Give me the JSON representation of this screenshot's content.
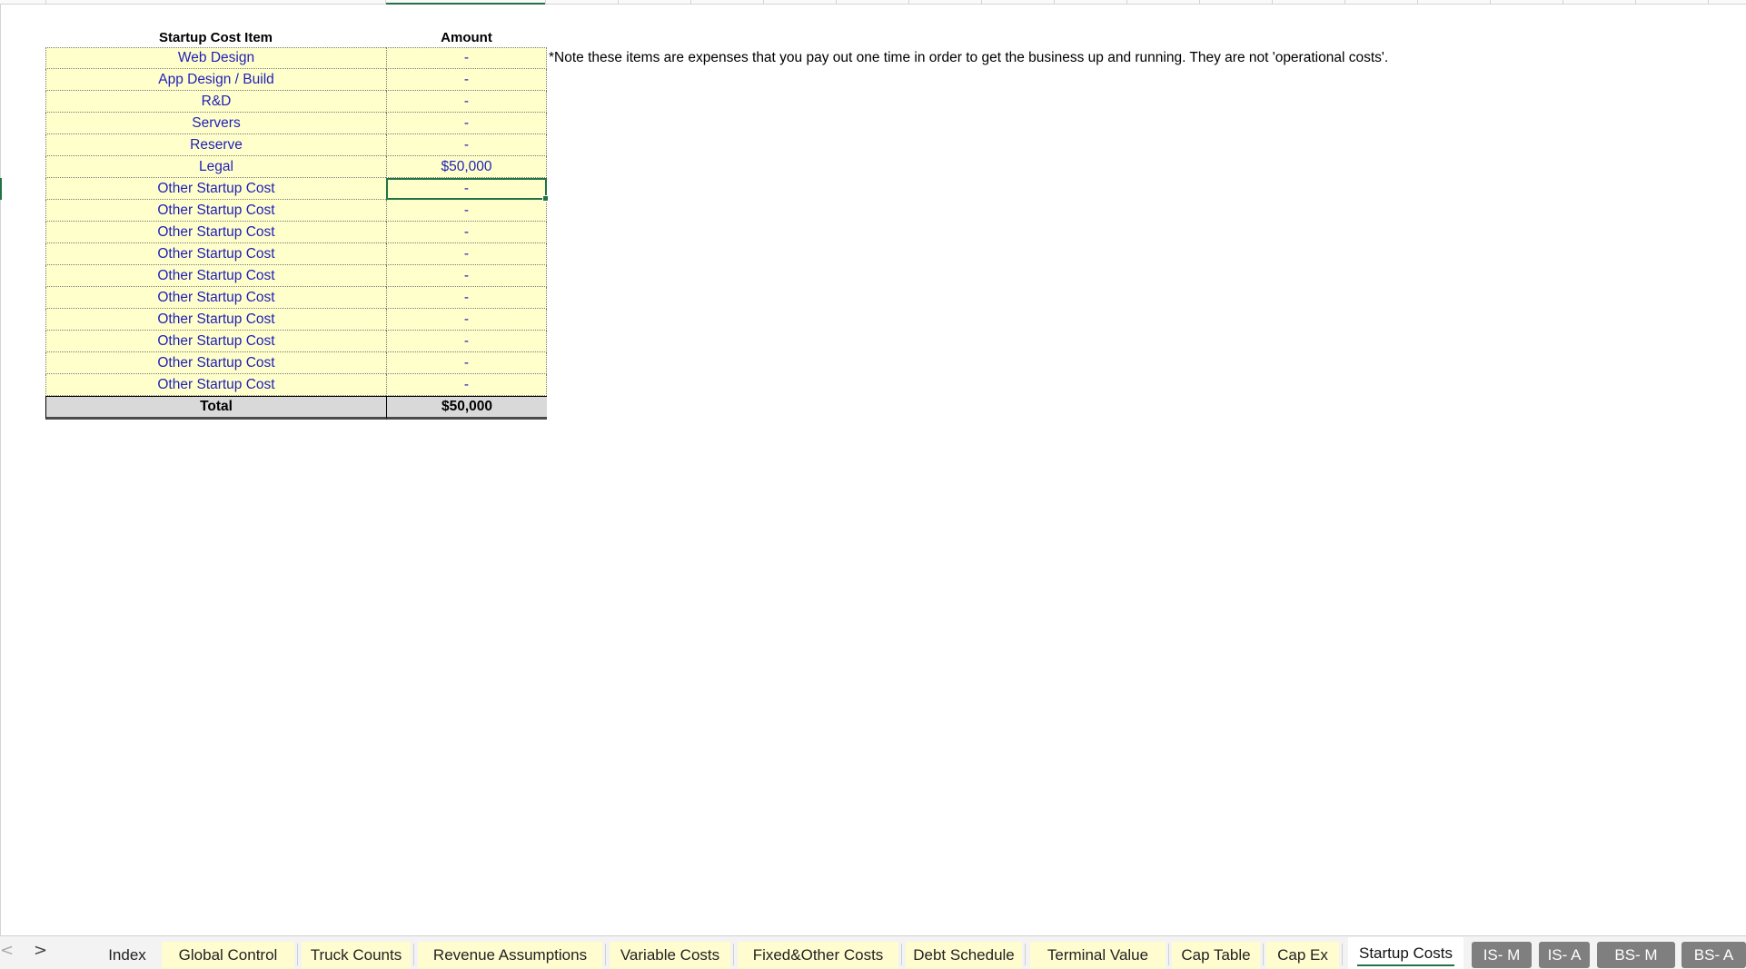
{
  "table": {
    "header": {
      "item": "Startup Cost Item",
      "amount": "Amount"
    },
    "rows": [
      {
        "item": "Web Design",
        "amount": "-"
      },
      {
        "item": "App Design / Build",
        "amount": "-"
      },
      {
        "item": "R&D",
        "amount": "-"
      },
      {
        "item": "Servers",
        "amount": "-"
      },
      {
        "item": "Reserve",
        "amount": "-"
      },
      {
        "item": "Legal",
        "amount": "$50,000"
      },
      {
        "item": "Other Startup Cost",
        "amount": "-"
      },
      {
        "item": "Other Startup Cost",
        "amount": "-"
      },
      {
        "item": "Other Startup Cost",
        "amount": "-"
      },
      {
        "item": "Other Startup Cost",
        "amount": "-"
      },
      {
        "item": "Other Startup Cost",
        "amount": "-"
      },
      {
        "item": "Other Startup Cost",
        "amount": "-"
      },
      {
        "item": "Other Startup Cost",
        "amount": "-"
      },
      {
        "item": "Other Startup Cost",
        "amount": "-"
      },
      {
        "item": "Other Startup Cost",
        "amount": "-"
      },
      {
        "item": "Other Startup Cost",
        "amount": "-"
      }
    ],
    "total": {
      "item": "Total",
      "amount": "$50,000"
    },
    "selected_row_index": 6
  },
  "note": "*Note these items are expenses that you pay out one time in order to get the business up and running. They are not 'operational costs'.",
  "tabs": {
    "prev_icon": "chevron-left-icon",
    "next_icon": "chevron-right-icon",
    "prev_glyph": "<",
    "next_glyph": ">",
    "items": [
      {
        "label": "Index",
        "style": "plain"
      },
      {
        "label": "Global Control",
        "style": "yellow"
      },
      {
        "label": "Truck Counts",
        "style": "yellow"
      },
      {
        "label": "Revenue Assumptions",
        "style": "yellow"
      },
      {
        "label": "Variable Costs",
        "style": "yellow"
      },
      {
        "label": "Fixed&Other Costs",
        "style": "yellow"
      },
      {
        "label": "Debt Schedule",
        "style": "yellow"
      },
      {
        "label": "Terminal Value",
        "style": "yellow"
      },
      {
        "label": "Cap Table",
        "style": "yellow"
      },
      {
        "label": "Cap Ex",
        "style": "yellow"
      },
      {
        "label": "Startup Costs",
        "style": "active"
      },
      {
        "label": "IS- M",
        "style": "gray"
      },
      {
        "label": "IS- A",
        "style": "gray"
      },
      {
        "label": "BS- M",
        "style": "gray"
      },
      {
        "label": "BS- A",
        "style": "gray"
      }
    ]
  },
  "colors": {
    "input_fill": "#ffffcc",
    "input_text": "#1f1fb8",
    "total_fill": "#d9d9d9",
    "selection": "#217346",
    "tab_yellow": "#fffdd0",
    "tab_gray": "#7f7f7f"
  }
}
